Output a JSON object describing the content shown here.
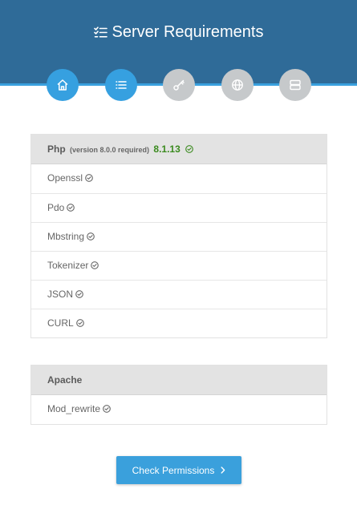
{
  "header": {
    "title": "Server Requirements",
    "title_icon": "checklist-icon",
    "background": "#2f6b98",
    "accent": "#39a0de"
  },
  "steps": [
    {
      "icon": "home-icon",
      "active": true
    },
    {
      "icon": "list-icon",
      "active": true
    },
    {
      "icon": "key-icon",
      "active": false
    },
    {
      "icon": "globe-icon",
      "active": false
    },
    {
      "icon": "server-icon",
      "active": false
    }
  ],
  "php": {
    "label": "Php",
    "requirement": "(version 8.0.0 required)",
    "version": "8.1.13",
    "version_color": "#3a8a1e",
    "extensions": [
      "Openssl",
      "Pdo",
      "Mbstring",
      "Tokenizer",
      "JSON",
      "CURL"
    ]
  },
  "apache": {
    "label": "Apache",
    "modules": [
      "Mod_rewrite"
    ]
  },
  "button": {
    "label": "Check Permissions",
    "icon": "chevron-right-icon",
    "color": "#3aa0dc"
  }
}
